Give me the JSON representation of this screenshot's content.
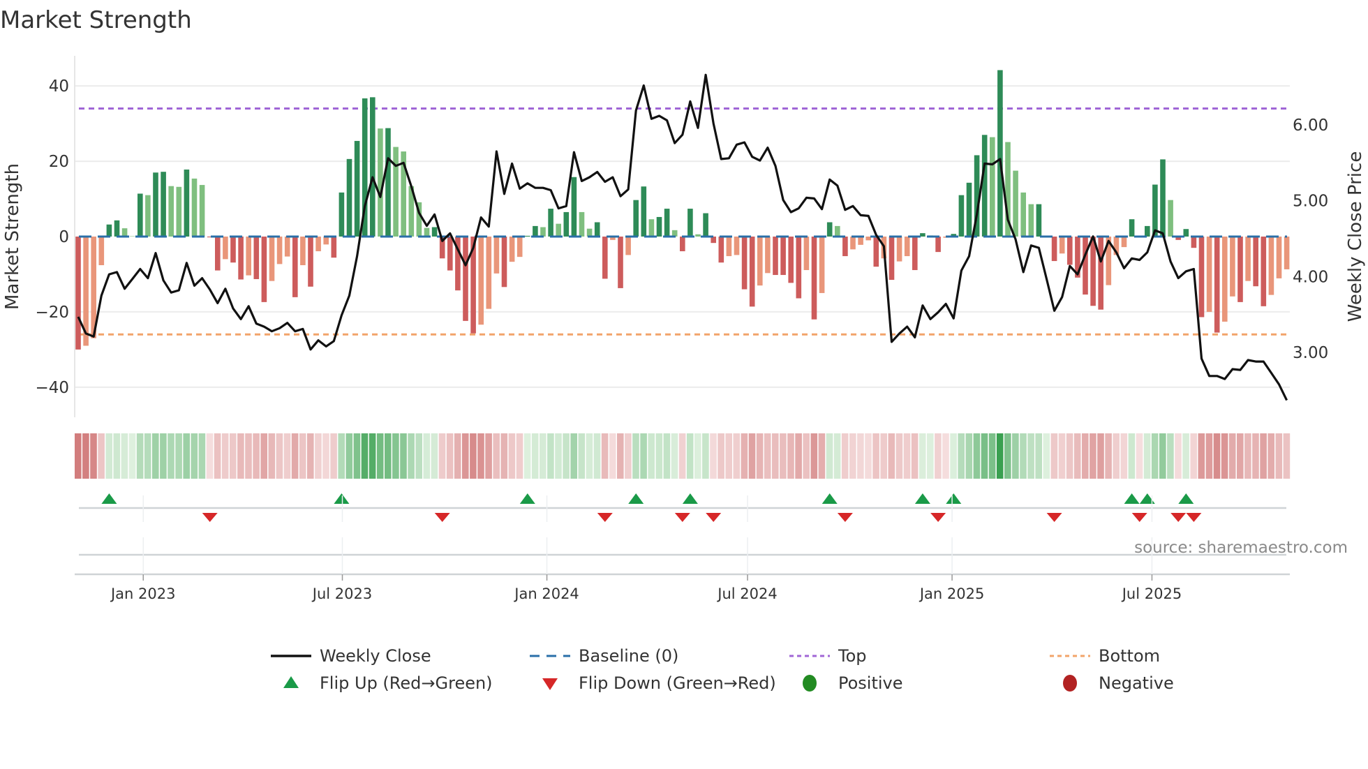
{
  "chart_data": {
    "type": "bar",
    "title": "Market Strength",
    "ylabel": "Market Strength",
    "y2label": "Weekly Close Price",
    "ylim": [
      -48,
      48
    ],
    "y2lim": [
      2.14,
      6.91
    ],
    "yticks": [
      40,
      20,
      0,
      -20,
      -40
    ],
    "yticklabels": [
      "40",
      "20",
      "0",
      "−20",
      "−40"
    ],
    "y2ticks": [
      6,
      5,
      4,
      3
    ],
    "y2ticklabels": [
      "6.00",
      "5.00",
      "4.00",
      "3.00"
    ],
    "x_ticks": [
      {
        "label": "Jan 2023",
        "week": 8.4
      },
      {
        "label": "Jul 2023",
        "week": 34.1
      },
      {
        "label": "Jan 2024",
        "week": 60.5
      },
      {
        "label": "Jul 2024",
        "week": 86.4
      },
      {
        "label": "Jan 2025",
        "week": 112.8
      },
      {
        "label": "Jul 2025",
        "week": 138.6
      }
    ],
    "top_level": 34,
    "bottom_level": -26,
    "baseline": 0,
    "strength": [
      -30,
      -29,
      -27,
      -7.6,
      3.2,
      4.3,
      2.2,
      0.1,
      11.4,
      11,
      17,
      17.2,
      13.4,
      13.2,
      17.8,
      15.4,
      13.7,
      -0.2,
      -9,
      -6,
      -6.9,
      -11.4,
      -10.3,
      -11.3,
      -17.4,
      -11.8,
      -7.3,
      -5.3,
      -16.1,
      -7.6,
      -13.3,
      -3.9,
      -2.1,
      -5.6,
      11.7,
      20.6,
      25.4,
      36.7,
      37,
      28.7,
      28.8,
      23.8,
      22.6,
      13.4,
      9.1,
      2.3,
      2.5,
      -5.8,
      -9,
      -14.3,
      -22.4,
      -25.7,
      -23.4,
      -19.2,
      -9.8,
      -13.4,
      -6.7,
      -5.4,
      0.2,
      2.8,
      2.5,
      7.4,
      3.4,
      6.5,
      15.8,
      6.5,
      2.1,
      3.8,
      -11.2,
      -0.9,
      -13.7,
      -4.9,
      9.7,
      13.3,
      4.6,
      5.2,
      7.4,
      1.7,
      -3.9,
      7.4,
      0.6,
      6.2,
      -1.7,
      -6.9,
      -5.2,
      -4.9,
      -14,
      -18.6,
      -13,
      -9.7,
      -10.2,
      -10.2,
      -12.3,
      -16.4,
      -8.9,
      -22,
      -15,
      3.8,
      2.8,
      -5.2,
      -3.4,
      -2.2,
      -1,
      -8,
      -5.8,
      -11.5,
      -6.6,
      -5.2,
      -8.9,
      0.9,
      0.3,
      -4.1,
      -0.3,
      0.7,
      11,
      14.3,
      21.6,
      27,
      26.4,
      44.2,
      25.1,
      17.5,
      11.7,
      8.6,
      8.6,
      0.2,
      -6.5,
      -4.5,
      -7.5,
      -10.9,
      -15.4,
      -18.4,
      -19.4,
      -12.9,
      -4.9,
      -2.8,
      4.6,
      0,
      2.8,
      13.8,
      20.5,
      9.7,
      -0.9,
      2,
      -3,
      -21.4,
      -20,
      -25.5,
      -22.6,
      -15.9,
      -17.4,
      -11.8,
      -13.2,
      -18.5,
      -15.5,
      -11.1,
      -8.7
    ],
    "weekly_close": [
      3.47,
      3.25,
      3.21,
      3.75,
      4.03,
      4.06,
      3.84,
      3.97,
      4.1,
      3.98,
      4.31,
      3.95,
      3.79,
      3.82,
      4.18,
      3.88,
      3.98,
      3.83,
      3.65,
      3.84,
      3.58,
      3.44,
      3.61,
      3.38,
      3.34,
      3.28,
      3.32,
      3.39,
      3.28,
      3.31,
      3.04,
      3.16,
      3.08,
      3.15,
      3.49,
      3.75,
      4.27,
      4.93,
      5.31,
      5.05,
      5.56,
      5.46,
      5.5,
      5.19,
      4.84,
      4.67,
      4.82,
      4.47,
      4.57,
      4.36,
      4.15,
      4.38,
      4.78,
      4.66,
      5.65,
      5.09,
      5.49,
      5.16,
      5.23,
      5.17,
      5.17,
      5.14,
      4.9,
      4.93,
      5.64,
      5.26,
      5.31,
      5.38,
      5.25,
      5.31,
      5.06,
      5.15,
      6.19,
      6.52,
      6.08,
      6.12,
      6.06,
      5.76,
      5.87,
      6.31,
      5.96,
      6.66,
      6.02,
      5.55,
      5.56,
      5.74,
      5.77,
      5.58,
      5.53,
      5.7,
      5.46,
      5.01,
      4.85,
      4.9,
      5.04,
      5.03,
      4.89,
      5.28,
      5.2,
      4.88,
      4.93,
      4.81,
      4.8,
      4.55,
      4.4,
      3.14,
      3.25,
      3.34,
      3.2,
      3.62,
      3.44,
      3.53,
      3.64,
      3.45,
      4.08,
      4.27,
      4.82,
      5.49,
      5.48,
      5.55,
      4.75,
      4.49,
      4.06,
      4.41,
      4.38,
      3.97,
      3.55,
      3.73,
      4.14,
      4.03,
      4.29,
      4.53,
      4.2,
      4.47,
      4.32,
      4.11,
      4.24,
      4.22,
      4.32,
      4.61,
      4.57,
      4.2,
      3.98,
      4.07,
      4.1,
      2.92,
      2.69,
      2.69,
      2.65,
      2.78,
      2.77,
      2.9,
      2.88,
      2.88,
      2.73,
      2.58,
      2.37
    ],
    "legend": {
      "placement": "bottom-center",
      "items": [
        {
          "label": "Weekly Close",
          "kind": "line",
          "color": "#111111"
        },
        {
          "label": "Baseline (0)",
          "kind": "dashed",
          "color": "#2a6fa8"
        },
        {
          "label": "Top",
          "kind": "dotted",
          "color": "#a066d6"
        },
        {
          "label": "Bottom",
          "kind": "dotted",
          "color": "#f2a46a"
        },
        {
          "label": "Flip Up (Red→Green)",
          "kind": "triangle-up",
          "color": "#1a9a48"
        },
        {
          "label": "Flip Down (Green→Red)",
          "kind": "triangle-down",
          "color": "#d62728"
        },
        {
          "label": "Positive",
          "kind": "circle",
          "color": "#228b22"
        },
        {
          "label": "Negative",
          "kind": "circle",
          "color": "#b22222"
        }
      ]
    },
    "source": "source: sharemaestro.com",
    "colors": {
      "pos_strong": "#2e8b57",
      "pos_weak": "#7fbf7f",
      "neg_strong": "#cd5c5c",
      "neg_weak": "#e9967a",
      "grid": "#ececec",
      "axis": "#cccccc"
    }
  }
}
